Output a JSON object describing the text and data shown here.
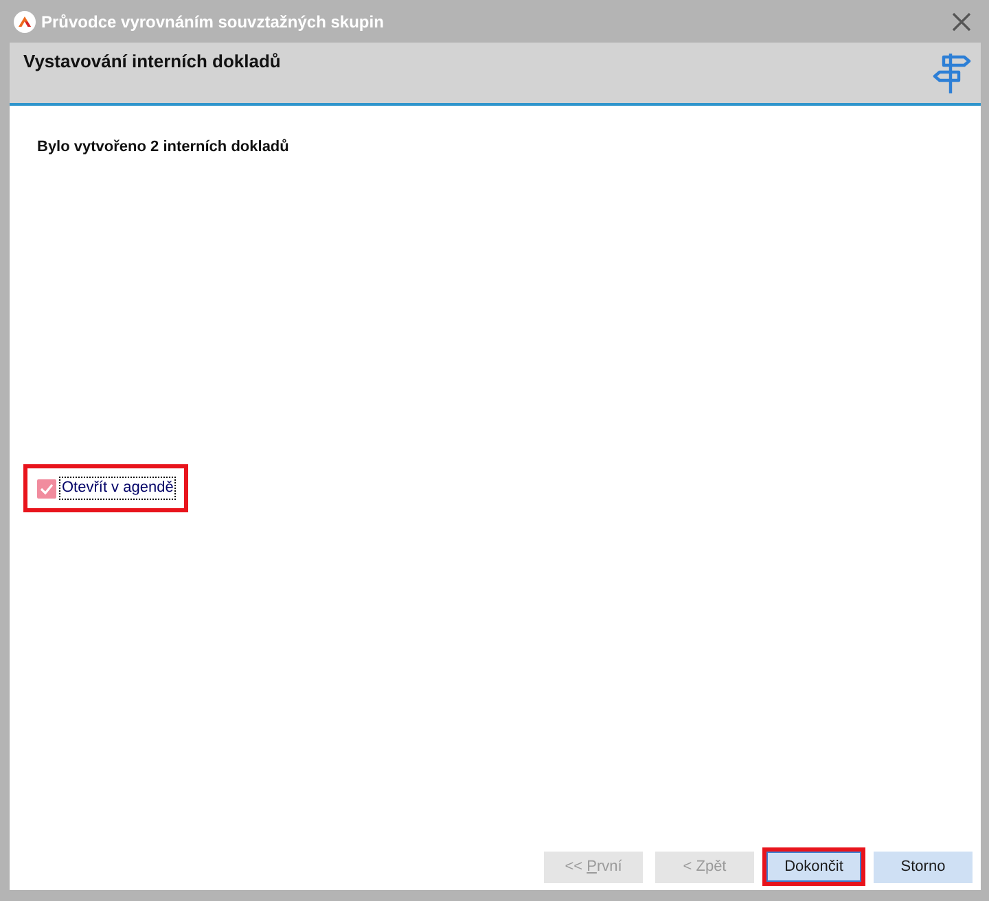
{
  "window": {
    "title": "Průvodce vyrovnáním souvztažných skupin"
  },
  "header": {
    "title": "Vystavování interních dokladů"
  },
  "message": "Bylo vytvořeno 2 interních dokladů",
  "open_in_agenda": {
    "label": "Otevřít v agendě",
    "checked": true,
    "focused": true,
    "highlighted": true
  },
  "buttons": [
    {
      "label": "<< ",
      "access_key": "P",
      "label_rest": "rvní",
      "disabled": true,
      "focused": false,
      "highlighted": false
    },
    {
      "label": "< Zpět",
      "disabled": true,
      "focused": false,
      "highlighted": false
    },
    {
      "label": "Dokončit",
      "disabled": false,
      "focused": true,
      "highlighted": true
    },
    {
      "label": "Storno",
      "disabled": false,
      "focused": false,
      "highlighted": false
    }
  ]
}
